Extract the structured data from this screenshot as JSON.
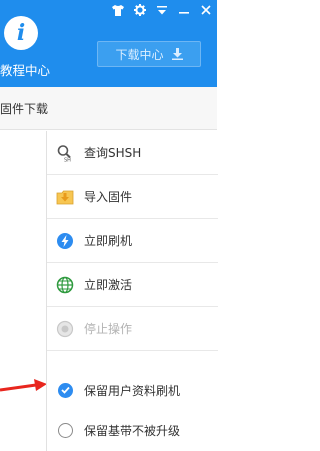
{
  "colors": {
    "brand_blue": "#1f8ded",
    "check_blue": "#2d8cf0",
    "arrow_red": "#e8261e"
  },
  "window_controls": [
    {
      "name": "tshirt-icon"
    },
    {
      "name": "gear-icon"
    },
    {
      "name": "menu-icon"
    },
    {
      "name": "minimize-icon"
    },
    {
      "name": "close-icon"
    }
  ],
  "header": {
    "logo_letter": "i",
    "label": "教程中心",
    "download_center": "下载中心"
  },
  "tabs": {
    "firmware_download": "固件下载"
  },
  "actions": [
    {
      "label": "查询SHSH",
      "icon": "search-shsh-icon",
      "enabled": true
    },
    {
      "label": "导入固件",
      "icon": "import-folder-icon",
      "enabled": true
    },
    {
      "label": "立即刷机",
      "icon": "flash-lightning-icon",
      "enabled": true
    },
    {
      "label": "立即激活",
      "icon": "globe-activate-icon",
      "enabled": true
    },
    {
      "label": "停止操作",
      "icon": "stop-icon",
      "enabled": false
    }
  ],
  "options": [
    {
      "label": "保留用户资料刷机",
      "checked": true
    },
    {
      "label": "保留基带不被升级",
      "checked": false
    }
  ]
}
